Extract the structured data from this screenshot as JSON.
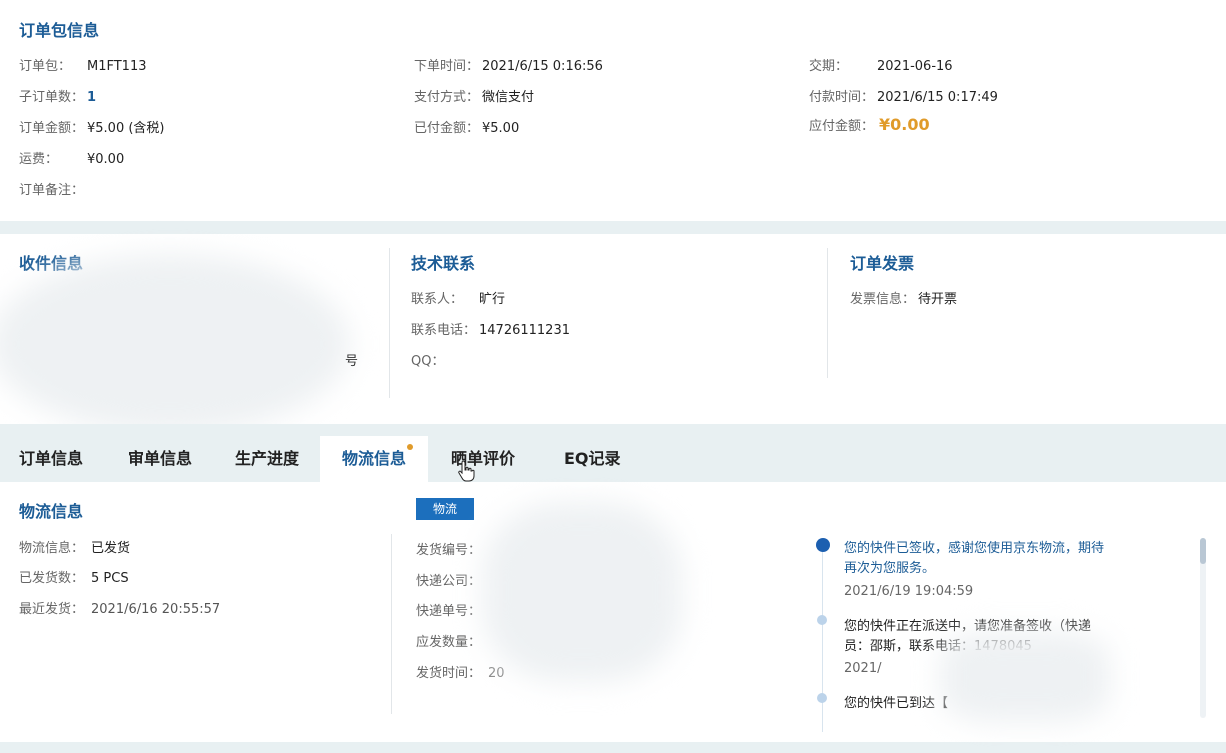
{
  "order": {
    "title": "订单包信息",
    "package_label": "订单包：",
    "package_value": "M1FT113",
    "sub_count_label": "子订单数：",
    "sub_count_value": "1",
    "amount_label": "订单金额：",
    "amount_value": "¥5.00 (含税)",
    "freight_label": "运费：",
    "freight_value": "¥0.00",
    "remark_label": "订单备注：",
    "order_time_label": "下单时间：",
    "order_time_value": "2021/6/15 0:16:56",
    "payment_label": "支付方式：",
    "payment_value": "微信支付",
    "paid_label": "已付金额：",
    "paid_value": "¥5.00",
    "delivery_label": "交期：",
    "delivery_value": "2021-06-16",
    "pay_time_label": "付款时间：",
    "pay_time_value": "2021/6/15 0:17:49",
    "due_label": "应付金额：",
    "due_value": "¥0.00"
  },
  "receiver": {
    "title": "收件信息",
    "partial_text": "号"
  },
  "tech": {
    "title": "技术联系",
    "contact_label": "联系人：",
    "contact_value": "旷行",
    "phone_label": "联系电话：",
    "phone_value": "14726111231",
    "qq_label": "QQ："
  },
  "invoice": {
    "title": "订单发票",
    "info_label": "发票信息：",
    "info_value": "待开票"
  },
  "tabs": [
    "订单信息",
    "审单信息",
    "生产进度",
    "物流信息",
    "晒单评价",
    "EQ记录"
  ],
  "logistics": {
    "title": "物流信息",
    "status_label": "物流信息：",
    "status_value": "已发货",
    "shipped_label": "已发货数：",
    "shipped_value": "5 PCS",
    "recent_label": "最近发货：",
    "recent_value": "2021/6/16 20:55:57",
    "badge": "物流",
    "ship_no_label": "发货编号：",
    "courier_label": "快递公司：",
    "tracking_label": "快递单号：",
    "qty_label": "应发数量：",
    "ship_time_label": "发货时间：",
    "ship_time_partial": "20"
  },
  "timeline": [
    {
      "text": "您的快件已签收，感谢您使用京东物流，期待再次为您服务。",
      "time": "2021/6/19 19:04:59"
    },
    {
      "text": "您的快件正在派送中，请您准备签收（快递员：邵斯，联系电话：1478045",
      "time": "2021/"
    },
    {
      "text": "您的快件已到达【",
      "time": ""
    }
  ],
  "colors": {
    "title_blue": "#1c5c96",
    "badge_blue": "#1c6fbd",
    "gold": "#e09b2a",
    "background": "#e8f0f2"
  }
}
